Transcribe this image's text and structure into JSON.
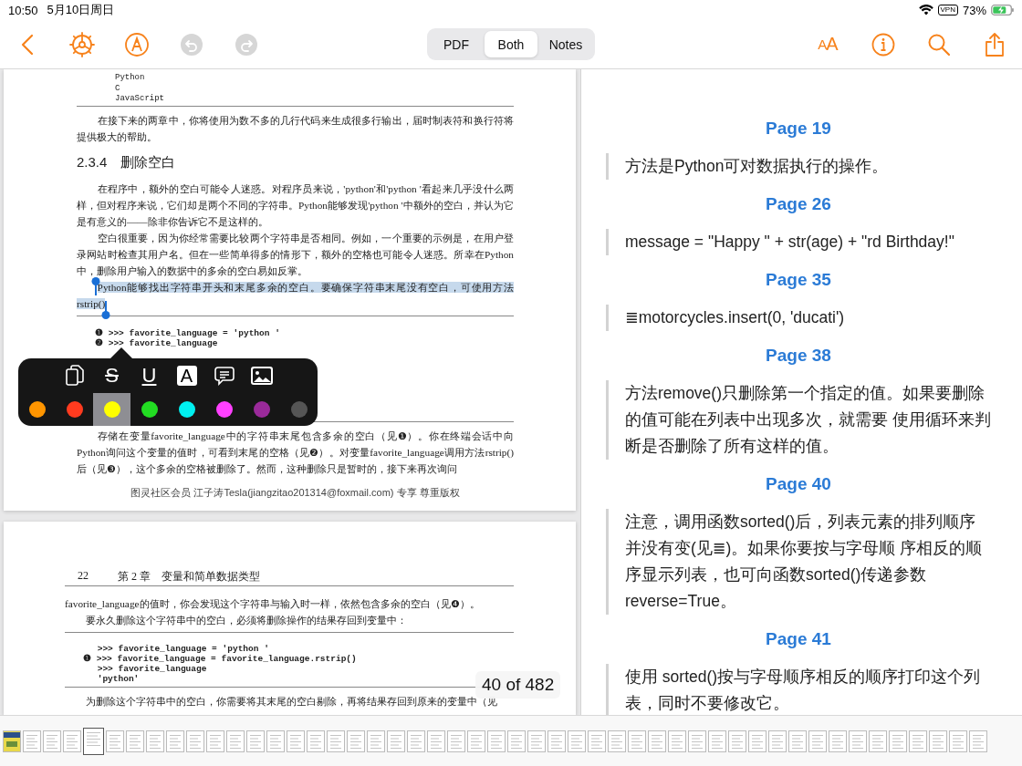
{
  "status_bar": {
    "time": "10:50",
    "date": "5月10日周日",
    "vpn": "VPN",
    "battery": "73%"
  },
  "toolbar": {
    "undo_enabled": false,
    "redo_enabled": false,
    "text_size": "AA",
    "view_modes": [
      {
        "label": "PDF",
        "selected": false
      },
      {
        "label": "Both",
        "selected": true
      },
      {
        "label": "Notes",
        "selected": false
      }
    ]
  },
  "pdf_pages": [
    {
      "blocks": [
        {
          "kind": "code",
          "lines": [
            "Python",
            "C",
            "JavaScript"
          ],
          "indent": true
        },
        {
          "kind": "rule"
        },
        {
          "kind": "paragraph",
          "indent": true,
          "selected": false,
          "text": "在接下来的两章中，你将使用为数不多的几行代码来生成很多行输出，届时制表符和换行符将提供极大的帮助。"
        },
        {
          "kind": "heading",
          "text": "2.3.4　删除空白"
        },
        {
          "kind": "paragraph",
          "indent": true,
          "selected": false,
          "text": "在程序中，额外的空白可能令人迷惑。对程序员来说，'python'和'python '看起来几乎没什么两样，但对程序来说，它们却是两个不同的字符串。Python能够发现'python '中额外的空白，并认为它是有意义的——除非你告诉它不是这样的。"
        },
        {
          "kind": "paragraph",
          "indent": true,
          "selected": false,
          "text": "空白很重要，因为你经常需要比较两个字符串是否相同。例如，一个重要的示例是，在用户登录网站时检查其用户名。但在一些简单得多的情形下，额外的空格也可能令人迷惑。所幸在Python中，删除用户输入的数据中的多余的空白易如反掌。"
        },
        {
          "kind": "paragraph",
          "indent": true,
          "selected": true,
          "text": "Python能够找出字符串开头和末尾多余的空白。要确保字符串末尾没有空白，可使用方法rstrip()"
        },
        {
          "kind": "rule"
        },
        {
          "kind": "code",
          "indent": false,
          "lines": [
            "❶ >>> favorite_language = 'python '",
            "❷ >>> favorite_language"
          ]
        },
        {
          "kind": "rule"
        },
        {
          "kind": "paragraph",
          "indent": true,
          "selected": false,
          "text": "存储在变量favorite_language中的字符串末尾包含多余的空白（见❶）。你在终端会话中向Python询问这个变量的值时，可看到末尾的空格（见❷）。对变量favorite_language调用方法rstrip()后（见❸），这个多余的空格被删除了。然而，这种删除只是暂时的，接下来再次询问"
        }
      ],
      "footer": "图灵社区会员 江子涛Tesla(jiangzitao201314@foxmail.com) 专享 尊重版权"
    },
    {
      "header_number": "22",
      "header_title": "第 2 章　变量和简单数据类型",
      "blocks": [
        {
          "kind": "paragraph",
          "indent": false,
          "selected": false,
          "text": "favorite_language的值时，你会发现这个字符串与输入时一样，依然包含多余的空白（见❹）。"
        },
        {
          "kind": "paragraph",
          "indent": true,
          "selected": false,
          "text": "要永久删除这个字符串中的空白，必须将删除操作的结果存回到变量中："
        },
        {
          "kind": "rule"
        },
        {
          "kind": "code",
          "indent": false,
          "lines": [
            "　 >>> favorite_language = 'python '",
            "❶ >>> favorite_language = favorite_language.rstrip()",
            "　 >>> favorite_language",
            "　 'python'"
          ]
        },
        {
          "kind": "rule"
        },
        {
          "kind": "paragraph",
          "indent": true,
          "selected": false,
          "text": "为删除这个字符串中的空白，你需要将其末尾的空白剔除，再将结果存回到原来的变量中（见"
        }
      ]
    }
  ],
  "page_counter": "40 of 482",
  "annotation_menu": {
    "tools": [
      {
        "kind": "copy"
      },
      {
        "kind": "strikethrough",
        "label": "S"
      },
      {
        "kind": "underline",
        "label": "U"
      },
      {
        "kind": "highlight",
        "label": "A"
      },
      {
        "kind": "comment"
      },
      {
        "kind": "image"
      }
    ],
    "colors": [
      {
        "color": "#ff9500",
        "selected": false
      },
      {
        "color": "#ff3b1f",
        "selected": false
      },
      {
        "color": "#ffff00",
        "selected": true
      },
      {
        "color": "#22dd22",
        "selected": false
      },
      {
        "color": "#00f0f0",
        "selected": false
      },
      {
        "color": "#ff40ff",
        "selected": false
      },
      {
        "color": "#9a2a9a",
        "selected": false
      },
      {
        "color": "#555555",
        "selected": false
      }
    ]
  },
  "notes": [
    {
      "page": "Page 19",
      "text": "方法是Python可对数据执行的操作。"
    },
    {
      "page": "Page 26",
      "text": "message = \"Happy \" + str(age) + \"rd Birthday!\""
    },
    {
      "page": "Page 35",
      "text": "≣motorcycles.insert(0, 'ducati')"
    },
    {
      "page": "Page 38",
      "text": "方法remove()只删除第一个指定的值。如果要删除的值可能在列表中出现多次，就需要 使用循环来判断是否删除了所有这样的值。"
    },
    {
      "page": "Page 40",
      "text": "注意，调用函数sorted()后，列表元素的排列顺序并没有变(见≣)。如果你要按与字母顺 序相反的顺序显示列表，也可向函数sorted()传递参数reverse=True。"
    },
    {
      "page": "Page 41",
      "text": "使用 sorted()按与字母顺序相反的顺序打印这个列表，同时不要修改它。"
    }
  ],
  "thumbnails": [
    {
      "kind": "cover",
      "selected": false
    },
    {
      "kind": "page",
      "selected": false
    },
    {
      "kind": "page",
      "selected": false
    },
    {
      "kind": "page",
      "selected": false
    },
    {
      "kind": "page",
      "selected": true
    },
    {
      "kind": "page",
      "selected": false
    },
    {
      "kind": "page",
      "selected": false
    },
    {
      "kind": "page",
      "selected": false
    },
    {
      "kind": "page",
      "selected": false
    },
    {
      "kind": "page",
      "selected": false
    },
    {
      "kind": "page",
      "selected": false
    },
    {
      "kind": "page",
      "selected": false
    },
    {
      "kind": "page",
      "selected": false
    },
    {
      "kind": "page",
      "selected": false
    },
    {
      "kind": "page",
      "selected": false
    },
    {
      "kind": "page",
      "selected": false
    },
    {
      "kind": "page",
      "selected": false
    },
    {
      "kind": "page",
      "selected": false
    },
    {
      "kind": "page",
      "selected": false
    },
    {
      "kind": "page",
      "selected": false
    },
    {
      "kind": "page",
      "selected": false
    },
    {
      "kind": "page",
      "selected": false
    },
    {
      "kind": "page",
      "selected": false
    },
    {
      "kind": "page",
      "selected": false
    },
    {
      "kind": "page",
      "selected": false
    },
    {
      "kind": "page",
      "selected": false
    },
    {
      "kind": "page",
      "selected": false
    },
    {
      "kind": "page",
      "selected": false
    },
    {
      "kind": "page",
      "selected": false
    },
    {
      "kind": "page",
      "selected": false
    },
    {
      "kind": "page",
      "selected": false
    },
    {
      "kind": "page",
      "selected": false
    },
    {
      "kind": "page",
      "selected": false
    },
    {
      "kind": "page",
      "selected": false
    },
    {
      "kind": "page",
      "selected": false
    },
    {
      "kind": "page",
      "selected": false
    },
    {
      "kind": "page",
      "selected": false
    },
    {
      "kind": "page",
      "selected": false
    },
    {
      "kind": "page",
      "selected": false
    },
    {
      "kind": "page",
      "selected": false
    },
    {
      "kind": "page",
      "selected": false
    },
    {
      "kind": "page",
      "selected": false
    },
    {
      "kind": "page",
      "selected": false
    },
    {
      "kind": "page",
      "selected": false
    },
    {
      "kind": "page",
      "selected": false
    },
    {
      "kind": "page",
      "selected": false
    },
    {
      "kind": "page",
      "selected": false
    },
    {
      "kind": "page",
      "selected": false
    },
    {
      "kind": "page",
      "selected": false
    }
  ]
}
